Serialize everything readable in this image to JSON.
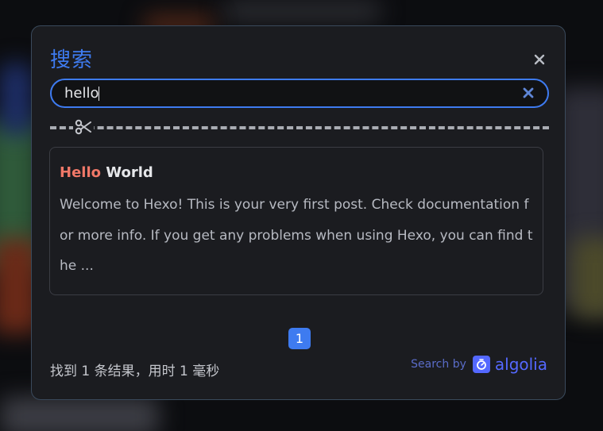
{
  "dialog": {
    "title": "搜索",
    "close_icon": "close-icon"
  },
  "search": {
    "value": "hello",
    "placeholder": "",
    "clear_icon": "clear-icon"
  },
  "divider": {
    "icon": "scissors-icon"
  },
  "results": [
    {
      "title_highlight": "Hello",
      "title_rest": " World",
      "snippet": "Welcome to Hexo! This is your very first post. Check documentation for more info. If you get any problems when using Hexo, you can find the ..."
    }
  ],
  "pagination": {
    "current_page": "1"
  },
  "footer": {
    "stats": "找到 1 条结果，用时 1 毫秒",
    "powered_by_label": "Search by",
    "provider_name": "algolia",
    "provider_color": "#5468ff"
  },
  "colors": {
    "accent": "#3e7bf0",
    "highlight": "#f07868"
  }
}
